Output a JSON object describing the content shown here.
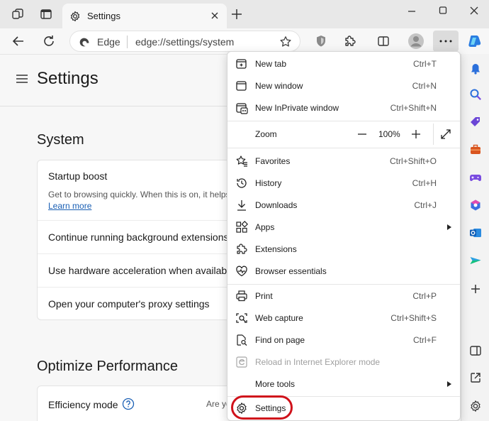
{
  "tab": {
    "title": "Settings"
  },
  "address_bar": {
    "chip": "Edge",
    "url": "edge://settings/system"
  },
  "page": {
    "title": "Settings",
    "sections": [
      {
        "title": "System",
        "rows": [
          {
            "label": "Startup boost",
            "description": "Get to browsing quickly. When this is on, it helps",
            "link": "Learn more"
          },
          {
            "label": "Continue running background extensions"
          },
          {
            "label": "Use hardware acceleration when available"
          },
          {
            "label": "Open your computer's proxy settings"
          }
        ]
      },
      {
        "title": "Optimize Performance",
        "rows": [
          {
            "label": "Efficiency mode",
            "trailing": "Are yo"
          }
        ]
      }
    ]
  },
  "menu": {
    "items": [
      {
        "label": "New tab",
        "shortcut": "Ctrl+T",
        "icon": "new-tab-icon"
      },
      {
        "label": "New window",
        "shortcut": "Ctrl+N",
        "icon": "new-window-icon"
      },
      {
        "label": "New InPrivate window",
        "shortcut": "Ctrl+Shift+N",
        "icon": "inprivate-icon"
      },
      {
        "label": "Zoom",
        "value": "100%",
        "icon": "zoom-icon"
      },
      {
        "label": "Favorites",
        "shortcut": "Ctrl+Shift+O",
        "icon": "favorites-icon"
      },
      {
        "label": "History",
        "shortcut": "Ctrl+H",
        "icon": "history-icon"
      },
      {
        "label": "Downloads",
        "shortcut": "Ctrl+J",
        "icon": "downloads-icon"
      },
      {
        "label": "Apps",
        "submenu": true,
        "icon": "apps-icon"
      },
      {
        "label": "Extensions",
        "icon": "extensions-icon"
      },
      {
        "label": "Browser essentials",
        "icon": "browser-essentials-icon"
      },
      {
        "label": "Print",
        "shortcut": "Ctrl+P",
        "icon": "print-icon"
      },
      {
        "label": "Web capture",
        "shortcut": "Ctrl+Shift+S",
        "icon": "web-capture-icon"
      },
      {
        "label": "Find on page",
        "shortcut": "Ctrl+F",
        "icon": "find-icon"
      },
      {
        "label": "Reload in Internet Explorer mode",
        "disabled": true,
        "icon": "ie-mode-icon"
      },
      {
        "label": "More tools",
        "submenu": true,
        "icon": "more-tools-icon"
      },
      {
        "label": "Settings",
        "highlighted": true,
        "icon": "settings-gear-icon"
      }
    ]
  },
  "colors": {
    "highlight": "#d0121b",
    "link": "#1a5fb4",
    "menu_button_active": "#dcdcdc"
  }
}
